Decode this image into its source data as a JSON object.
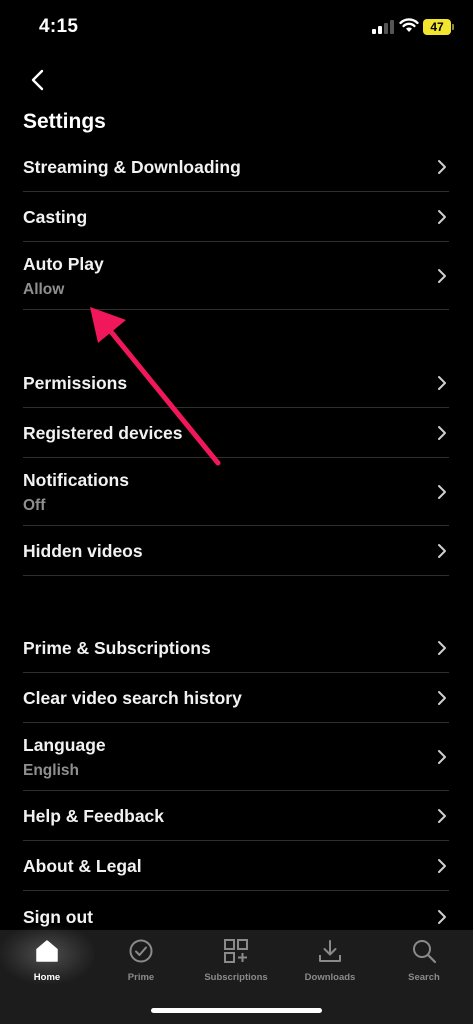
{
  "status": {
    "time": "4:15",
    "battery": "47"
  },
  "header": {
    "title": "Settings"
  },
  "settings": {
    "streaming": "Streaming & Downloading",
    "casting": "Casting",
    "autoplay": {
      "label": "Auto Play",
      "value": "Allow"
    },
    "permissions": "Permissions",
    "registered_devices": "Registered devices",
    "notifications": {
      "label": "Notifications",
      "value": "Off"
    },
    "hidden_videos": "Hidden videos",
    "prime_subscriptions": "Prime & Subscriptions",
    "clear_history": "Clear video search history",
    "language": {
      "label": "Language",
      "value": "English"
    },
    "help": "Help & Feedback",
    "about": "About & Legal",
    "sign_out": "Sign out"
  },
  "tabs": [
    {
      "label": "Home",
      "icon": "home-icon",
      "active": true
    },
    {
      "label": "Prime",
      "icon": "prime-check-icon",
      "active": false
    },
    {
      "label": "Subscriptions",
      "icon": "subscriptions-icon",
      "active": false
    },
    {
      "label": "Downloads",
      "icon": "download-icon",
      "active": false
    },
    {
      "label": "Search",
      "icon": "search-icon",
      "active": false
    }
  ],
  "colors": {
    "background": "#000000",
    "tab_bar": "#1c1c1c",
    "annotation_arrow": "#f0185a",
    "battery": "#f2e530"
  }
}
